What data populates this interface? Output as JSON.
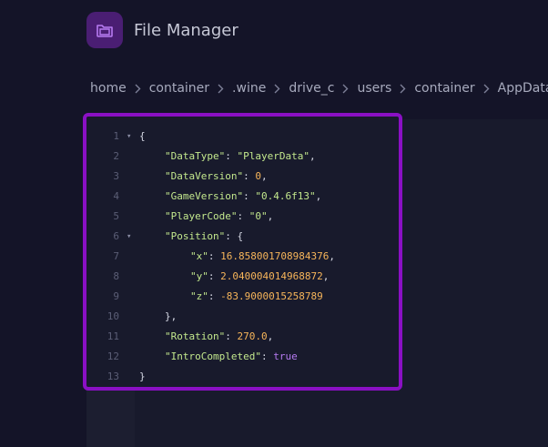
{
  "app": {
    "title": "File Manager",
    "icon": "folder-icon",
    "accent": "#8a10c4"
  },
  "breadcrumb": [
    "home",
    "container",
    ".wine",
    "drive_c",
    "users",
    "container",
    "AppData"
  ],
  "editor": {
    "lines": [
      {
        "n": "1",
        "fold": true,
        "parts": [
          [
            "punct",
            "{"
          ]
        ]
      },
      {
        "n": "2",
        "indent": 1,
        "parts": [
          [
            "key",
            "\"DataType\""
          ],
          [
            "punct",
            ": "
          ],
          [
            "str",
            "\"PlayerData\""
          ],
          [
            "punct",
            ","
          ]
        ]
      },
      {
        "n": "3",
        "indent": 1,
        "parts": [
          [
            "key",
            "\"DataVersion\""
          ],
          [
            "punct",
            ": "
          ],
          [
            "num",
            "0"
          ],
          [
            "punct",
            ","
          ]
        ]
      },
      {
        "n": "4",
        "indent": 1,
        "parts": [
          [
            "key",
            "\"GameVersion\""
          ],
          [
            "punct",
            ": "
          ],
          [
            "str",
            "\"0.4.6f13\""
          ],
          [
            "punct",
            ","
          ]
        ]
      },
      {
        "n": "5",
        "indent": 1,
        "parts": [
          [
            "key",
            "\"PlayerCode\""
          ],
          [
            "punct",
            ": "
          ],
          [
            "str",
            "\"0\""
          ],
          [
            "punct",
            ","
          ]
        ]
      },
      {
        "n": "6",
        "indent": 1,
        "fold": true,
        "parts": [
          [
            "key",
            "\"Position\""
          ],
          [
            "punct",
            ": {"
          ]
        ]
      },
      {
        "n": "7",
        "indent": 2,
        "parts": [
          [
            "key",
            "\"x\""
          ],
          [
            "punct",
            ": "
          ],
          [
            "num",
            "16.858001708984376"
          ],
          [
            "punct",
            ","
          ]
        ]
      },
      {
        "n": "8",
        "indent": 2,
        "parts": [
          [
            "key",
            "\"y\""
          ],
          [
            "punct",
            ": "
          ],
          [
            "num",
            "2.040004014968872"
          ],
          [
            "punct",
            ","
          ]
        ]
      },
      {
        "n": "9",
        "indent": 2,
        "parts": [
          [
            "key",
            "\"z\""
          ],
          [
            "punct",
            ": "
          ],
          [
            "num",
            "-83.9000015258789"
          ]
        ]
      },
      {
        "n": "10",
        "indent": 1,
        "parts": [
          [
            "punct",
            "},"
          ]
        ]
      },
      {
        "n": "11",
        "indent": 1,
        "parts": [
          [
            "key",
            "\"Rotation\""
          ],
          [
            "punct",
            ": "
          ],
          [
            "num",
            "270.0"
          ],
          [
            "punct",
            ","
          ]
        ]
      },
      {
        "n": "12",
        "indent": 1,
        "parts": [
          [
            "key",
            "\"IntroCompleted\""
          ],
          [
            "punct",
            ": "
          ],
          [
            "bool",
            "true"
          ]
        ]
      },
      {
        "n": "13",
        "parts": [
          [
            "punct",
            "}"
          ]
        ]
      }
    ]
  }
}
